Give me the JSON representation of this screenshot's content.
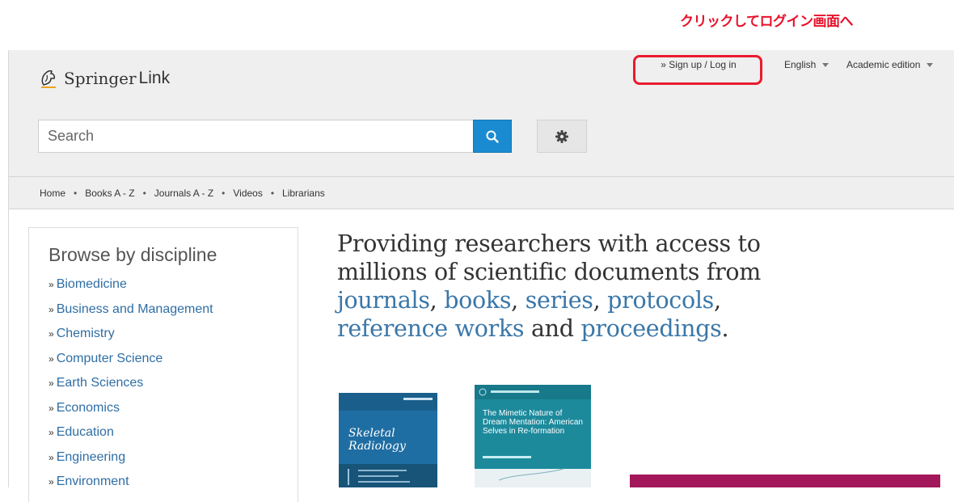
{
  "annotation": {
    "text": "クリックしてログイン画面へ",
    "color": "#e8102a"
  },
  "header": {
    "logo": {
      "word1": "Springer",
      "word2": "Link",
      "icon": "springer-horse-icon"
    },
    "signin_label": "» Sign up / Log in",
    "language": "English",
    "edition": "Academic edition",
    "search": {
      "placeholder": "Search"
    }
  },
  "nav": {
    "items": [
      {
        "label": "Home"
      },
      {
        "label": "Books A - Z"
      },
      {
        "label": "Journals A - Z"
      },
      {
        "label": "Videos"
      },
      {
        "label": "Librarians"
      }
    ],
    "separator": "•"
  },
  "sidebar": {
    "title": "Browse by discipline",
    "items": [
      {
        "prefix": "»",
        "label": "Biomedicine"
      },
      {
        "prefix": "»",
        "label": "Business and Management"
      },
      {
        "prefix": "»",
        "label": "Chemistry"
      },
      {
        "prefix": "»",
        "label": "Computer Science"
      },
      {
        "prefix": "»",
        "label": "Earth Sciences"
      },
      {
        "prefix": "»",
        "label": "Economics"
      },
      {
        "prefix": "»",
        "label": "Education"
      },
      {
        "prefix": "»",
        "label": "Engineering"
      },
      {
        "prefix": "»",
        "label": "Environment"
      }
    ]
  },
  "hero": {
    "line1": "Providing researchers with access to",
    "line2": "millions of scientific documents from",
    "journals": "journals",
    "books": "books",
    "series": "series",
    "protocols": "protocols",
    "reference": "reference works",
    "and": "and",
    "proceedings": "proceedings",
    "comma": ", ",
    "period": "."
  },
  "covers": [
    {
      "title": "Skeletal Radiology"
    },
    {
      "title": "The Mimetic Nature of Dream Mentation: American Selves in Re-formation"
    }
  ],
  "colors": {
    "accent": "#1a8bd0",
    "link": "#2f6ea5",
    "highlight": "#3b77a8",
    "signin_border": "#ea1b2d",
    "banner": "#a3185b"
  }
}
